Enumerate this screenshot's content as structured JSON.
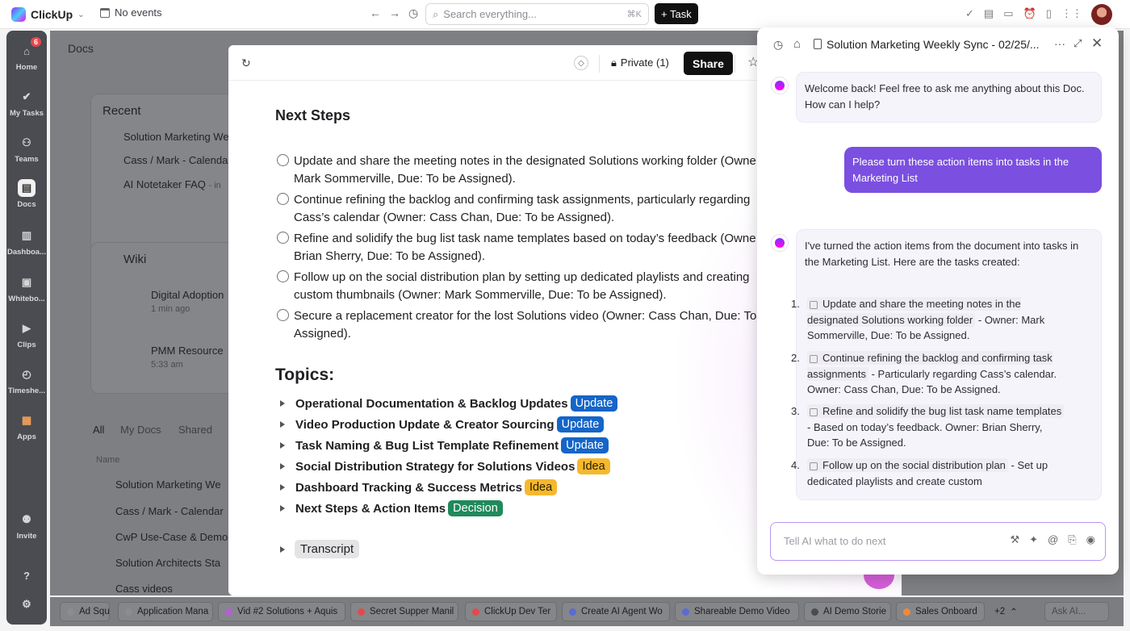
{
  "topbar": {
    "app_name": "ClickUp",
    "events": "No events",
    "search_placeholder": "Search everything...",
    "search_shortcut": "⌘K",
    "task_button": "+ Task"
  },
  "rail": {
    "home": "Home",
    "home_badge": "6",
    "my_tasks": "My Tasks",
    "teams": "Teams",
    "docs": "Docs",
    "dashboards": "Dashboa...",
    "whiteboards": "Whitebo...",
    "clips": "Clips",
    "timesheets": "Timeshe...",
    "apps": "Apps",
    "invite": "Invite"
  },
  "background": {
    "docs_title": "Docs",
    "recent_title": "Recent",
    "recent_items": [
      "Solution Marketing We",
      "Cass / Mark - Calenda",
      "AI Notetaker FAQ"
    ],
    "recent_item3_suffix": "- in",
    "wiki_title": "Wiki",
    "wiki_cards": [
      {
        "title": "Digital Adoption",
        "time": "1 min ago"
      },
      {
        "title": "PMM Resource",
        "time": "5:33 am"
      }
    ],
    "filter_tabs": [
      "All",
      "My Docs",
      "Shared"
    ],
    "name_header": "Name",
    "doc_rows": [
      "Solution Marketing We",
      "Cass / Mark - Calendar",
      "CwP Use-Case & Demo",
      "Solution Architects Sta",
      "Cass videos"
    ]
  },
  "bottom_tabs": [
    {
      "label": "Ad Squ",
      "color": "#8c8c8c"
    },
    {
      "label": "Application Mana",
      "color": "#8c8c8c"
    },
    {
      "label": "Vid #2 Solutions + Aquis",
      "color": "#b45fd6"
    },
    {
      "label": "Secret Supper Manil",
      "color": "#e5484d"
    },
    {
      "label": "ClickUp Dev Ter",
      "color": "#e5484d"
    },
    {
      "label": "Create AI Agent Wo",
      "color": "#5b6bd6"
    },
    {
      "label": "Shareable Demo Video",
      "color": "#5b6bd6"
    },
    {
      "label": "AI Demo Storie",
      "color": "#4a4c51"
    },
    {
      "label": "Sales Onboard",
      "color": "#f08a3a"
    },
    {
      "label": "+2",
      "color": ""
    },
    {
      "label": "Ask AI...",
      "color": ""
    }
  ],
  "doc": {
    "privacy": "Private (1)",
    "share": "Share",
    "next_steps_heading": "Next Steps",
    "steps": [
      [
        "Update and share the meeting notes in the designated Solutions working folder (Owne",
        "Mark Sommerville, Due: To be Assigned)."
      ],
      [
        "Continue refining the backlog and confirming task assignments, particularly regarding",
        "Cass’s calendar (Owner: Cass Chan, Due: To be Assigned)."
      ],
      [
        "Refine and solidify the bug list task name templates based on today’s feedback (Owne",
        "Brian Sherry, Due: To be Assigned)."
      ],
      [
        "Follow up on the social distribution plan by setting up dedicated playlists and creating",
        "custom thumbnails (Owner: Mark Sommerville, Due: To be Assigned)."
      ],
      [
        "Secure a replacement creator for the lost Solutions video (Owner: Cass Chan, Due: To",
        "Assigned)."
      ]
    ],
    "topics_heading": "Topics:",
    "topics": [
      {
        "title": "Operational Documentation & Backlog Updates",
        "tag": "Update",
        "kind": "update"
      },
      {
        "title": "Video Production Update & Creator Sourcing",
        "tag": "Update",
        "kind": "update"
      },
      {
        "title": "Task Naming & Bug List Template Refinement",
        "tag": "Update",
        "kind": "update"
      },
      {
        "title": "Social Distribution Strategy for Solutions Videos",
        "tag": "Idea",
        "kind": "idea"
      },
      {
        "title": "Dashboard Tracking & Success Metrics",
        "tag": "Idea",
        "kind": "idea"
      },
      {
        "title": "Next Steps & Action Items",
        "tag": "Decision",
        "kind": "decision"
      }
    ],
    "transcript": "Transcript"
  },
  "ai_panel": {
    "title": "Solution Marketing Weekly Sync - 02/25/...",
    "welcome": "Welcome back! Feel free to ask me anything about this Doc. How can I help?",
    "user_message": "Please turn these action items into tasks in the Marketing List",
    "response_intro": "I've turned the action items from the document into tasks in the Marketing List. Here are the tasks created:",
    "tasks": [
      {
        "num": "1.",
        "name": "Update and share the meeting notes in the designated Solutions working folder",
        "rest": "- Owner: Mark Sommerville, Due: To be Assigned."
      },
      {
        "num": "2.",
        "name": "Continue refining the backlog and confirming task assignments",
        "rest": "- Particularly regarding Cass’s calendar. Owner: Cass Chan, Due: To be Assigned."
      },
      {
        "num": "3.",
        "name": "Refine and solidify the bug list task name templates",
        "rest": "- Based on today’s feedback. Owner: Brian Sherry, Due: To be Assigned."
      },
      {
        "num": "4.",
        "name": "Follow up on the social distribution plan",
        "rest": "- Set up dedicated playlists and create custom"
      }
    ],
    "input_placeholder": "Tell AI what to do next"
  }
}
